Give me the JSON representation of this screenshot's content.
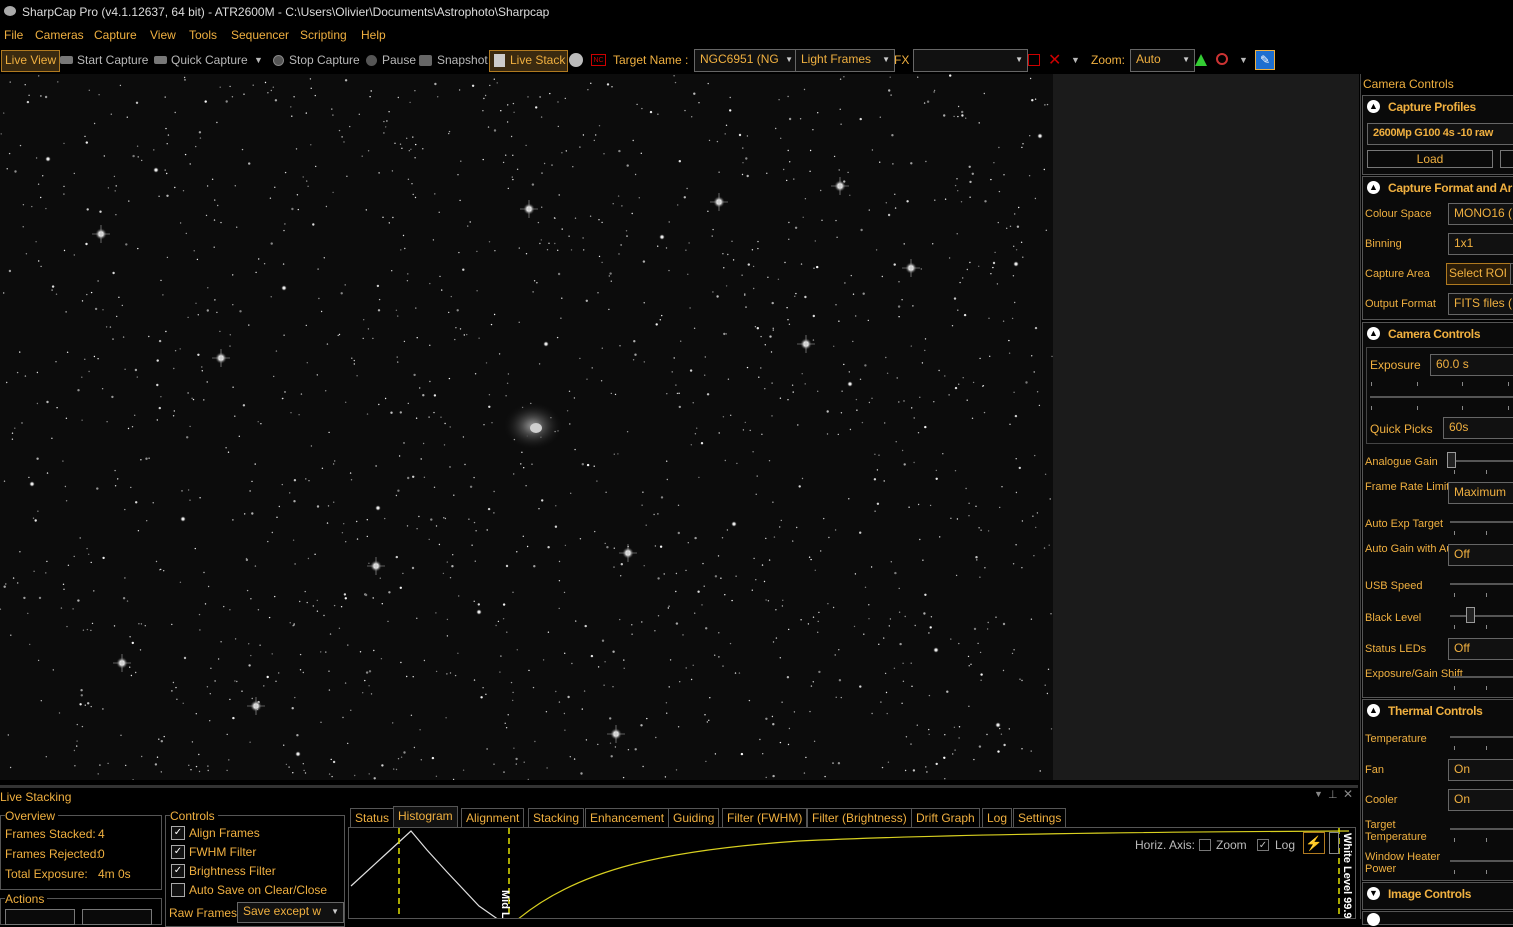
{
  "title": "SharpCap Pro (v4.1.12637, 64 bit) - ATR2600M - C:\\Users\\Olivier\\Documents\\Astrophoto\\Sharpcap",
  "menu": [
    "File",
    "Cameras",
    "Capture",
    "View",
    "Tools",
    "Sequencer",
    "Scripting",
    "Help"
  ],
  "toolbar": {
    "live_view": "Live View",
    "start_capture": "Start Capture",
    "quick_capture": "Quick Capture",
    "stop_capture": "Stop Capture",
    "pause": "Pause",
    "snapshot": "Snapshot",
    "live_stack": "Live Stack",
    "target_label": "Target Name :",
    "target_value": "NGC6951 (NG",
    "frame_type": "Light Frames",
    "fx_label": "FX",
    "fx_value": "",
    "zoom_label": "Zoom:",
    "zoom_value": "Auto"
  },
  "camera_panel": {
    "title": "Camera Controls",
    "capture_profiles": {
      "header": "Capture Profiles",
      "profile": "2600Mp G100 4s -10 raw",
      "load": "Load"
    },
    "capture_format": {
      "header": "Capture Format and Ar",
      "colour_space_label": "Colour Space",
      "colour_space": "MONO16 (",
      "binning_label": "Binning",
      "binning": "1x1",
      "capture_area_label": "Capture Area",
      "capture_area": "Select ROI",
      "output_format_label": "Output Format",
      "output_format": "FITS files ("
    },
    "camera_controls": {
      "header": "Camera Controls",
      "exposure_label": "Exposure",
      "exposure": "60.0 s",
      "quick_picks_label": "Quick Picks",
      "quick_picks": "60s",
      "analogue_gain_label": "Analogue Gain",
      "frame_rate_label": "Frame Rate Limit",
      "frame_rate": "Maximum",
      "auto_exp_target_label": "Auto Exp Target",
      "auto_gain_label": "Auto Gain with Auto Exposure",
      "auto_gain": "Off",
      "usb_speed_label": "USB Speed",
      "black_level_label": "Black Level",
      "status_leds_label": "Status LEDs",
      "status_leds": "Off",
      "exp_gain_shift_label": "Exposure/Gain Shift"
    },
    "thermal_controls": {
      "header": "Thermal Controls",
      "temperature_label": "Temperature",
      "fan_label": "Fan",
      "fan": "On",
      "cooler_label": "Cooler",
      "cooler": "On",
      "target_temp_label": "Target Temperature",
      "window_heater_label": "Window Heater Power"
    },
    "image_controls": {
      "header": "Image Controls"
    }
  },
  "live_stacking": {
    "title": "Live Stacking",
    "overview": {
      "title": "Overview",
      "frames_stacked_label": "Frames Stacked:",
      "frames_stacked": "4",
      "frames_rejected_label": "Frames Rejected:",
      "frames_rejected": "0",
      "total_exposure_label": "Total Exposure:",
      "total_exposure": "4m 0s"
    },
    "actions": {
      "title": "Actions"
    },
    "controls": {
      "title": "Controls",
      "align_frames": "Align Frames",
      "fwhm_filter": "FWHM Filter",
      "brightness_filter": "Brightness Filter",
      "auto_save": "Auto Save on Clear/Close",
      "raw_frames_label": "Raw Frames",
      "raw_frames": "Save except w"
    },
    "tabs": [
      "Status",
      "Histogram",
      "Alignment",
      "Stacking",
      "Enhancement",
      "Guiding",
      "Filter (FWHM)",
      "Filter (Brightness)",
      "Drift Graph",
      "Log",
      "Settings"
    ],
    "active_tab": "Histogram",
    "histogram": {
      "horiz_axis_label": "Horiz. Axis:",
      "zoom_label": "Zoom",
      "zoom_checked": false,
      "log_label": "Log",
      "log_checked": true,
      "mid_level_label": "Mid L",
      "white_level_label": "White Level 99.9"
    }
  },
  "colors": {
    "accent": "#f0b040",
    "background": "#000000",
    "image_bg": "#0c0c0c"
  }
}
